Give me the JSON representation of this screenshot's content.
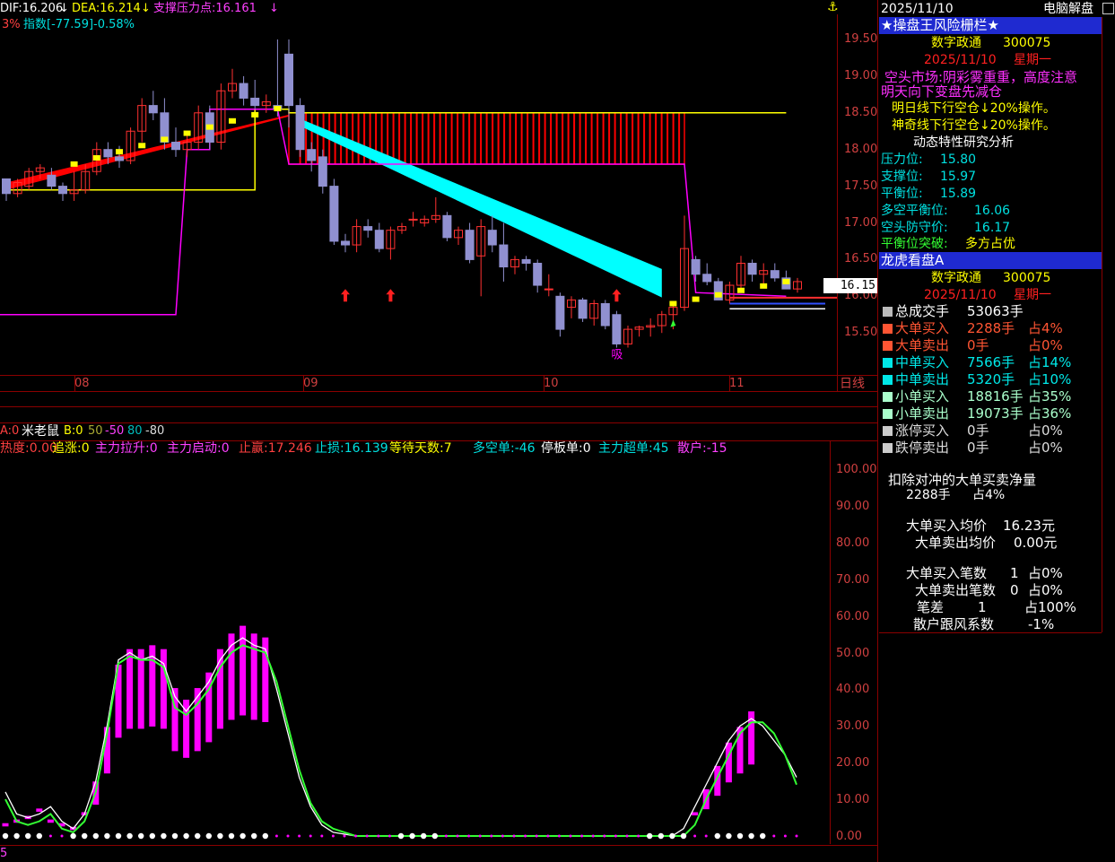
{
  "colors": {
    "bg": "#000000",
    "grid": "#8b0000",
    "red": "#ff0000",
    "cyan": "#00ffff",
    "yellow": "#ffff00",
    "magenta": "#ff00ff",
    "bull_candle": "#ff3030",
    "bear_candle": "#9090d0",
    "panel_title": "#1f2ad0",
    "green": "#33ff33"
  },
  "top": {
    "dif": "DIF:16.206",
    "dea": "DEA:16.214",
    "support": "支撑压力点:16.161",
    "line2_prefix": "3%",
    "line2_index": "指数[-77.59]-0.58%",
    "anchor_icon": "anchor-icon"
  },
  "price_axis": {
    "labels": [
      "19.50",
      "19.00",
      "18.50",
      "18.00",
      "17.50",
      "17.00",
      "16.50",
      "16.00",
      "15.50"
    ],
    "current": "16.15"
  },
  "time_axis": {
    "labels": [
      "08",
      "09",
      "10",
      "11"
    ],
    "period": "日线"
  },
  "indicator": {
    "name_a": "A:0",
    "name": "米老鼠",
    "name_b": "B:0",
    "levels": [
      "50",
      "-50",
      "80",
      "-80"
    ],
    "row2": [
      "热度:0.00",
      "追涨:0",
      "主力拉升:0",
      "主力启动:0",
      "止赢:17.246",
      "止损:16.139",
      "等待天数:7",
      "多空单:-46",
      "停板单:0",
      "主力超单:45",
      "散户:-15"
    ],
    "axis": [
      "100.00",
      "90.00",
      "80.00",
      "70.00",
      "60.00",
      "50.00",
      "40.00",
      "30.00",
      "20.00",
      "10.00",
      "0.00"
    ],
    "bottom_mark": "5"
  },
  "kline": {
    "marks": [
      "吸"
    ]
  },
  "chart_data": [
    {
      "type": "candlestick",
      "title": "",
      "ylim": [
        15.2,
        19.7
      ],
      "x_ticks": [
        "08",
        "09",
        "10",
        "11"
      ],
      "candles": [
        [
          17.6,
          17.6,
          17.3,
          17.4
        ],
        [
          17.4,
          17.6,
          17.35,
          17.55
        ],
        [
          17.5,
          17.75,
          17.45,
          17.7
        ],
        [
          17.7,
          17.8,
          17.6,
          17.75
        ],
        [
          17.65,
          17.75,
          17.45,
          17.5
        ],
        [
          17.5,
          17.55,
          17.3,
          17.4
        ],
        [
          17.4,
          17.7,
          17.3,
          17.45
        ],
        [
          17.45,
          17.8,
          17.4,
          17.7
        ],
        [
          17.7,
          18.1,
          17.65,
          18.0
        ],
        [
          18.0,
          18.1,
          17.8,
          17.9
        ],
        [
          17.9,
          18.05,
          17.75,
          17.85
        ],
        [
          17.85,
          18.3,
          17.8,
          18.25
        ],
        [
          18.25,
          18.7,
          18.1,
          18.6
        ],
        [
          18.6,
          18.8,
          18.4,
          18.5
        ],
        [
          18.5,
          18.7,
          18.0,
          18.1
        ],
        [
          18.1,
          18.3,
          17.9,
          18.0
        ],
        [
          18.0,
          18.2,
          17.9,
          18.1
        ],
        [
          18.1,
          18.6,
          18.0,
          18.5
        ],
        [
          18.5,
          18.6,
          18.0,
          18.1
        ],
        [
          18.1,
          18.9,
          18.0,
          18.8
        ],
        [
          18.8,
          19.1,
          18.7,
          18.9
        ],
        [
          18.9,
          19.0,
          18.6,
          18.7
        ],
        [
          18.7,
          18.95,
          18.55,
          18.6
        ],
        [
          18.6,
          18.75,
          18.5,
          18.65
        ],
        [
          18.6,
          19.5,
          18.45,
          18.55
        ],
        [
          19.3,
          19.5,
          18.3,
          18.6
        ],
        [
          18.6,
          18.7,
          17.9,
          18.0
        ],
        [
          18.0,
          18.1,
          17.7,
          17.85
        ],
        [
          17.9,
          18.0,
          17.4,
          17.5
        ],
        [
          17.5,
          17.6,
          16.7,
          16.75
        ],
        [
          16.75,
          16.85,
          16.6,
          16.7
        ],
        [
          16.7,
          17.05,
          16.6,
          16.95
        ],
        [
          16.95,
          17.05,
          16.8,
          16.9
        ],
        [
          16.9,
          17.0,
          16.6,
          16.65
        ],
        [
          16.65,
          16.95,
          16.5,
          16.9
        ],
        [
          16.9,
          17.0,
          16.85,
          16.95
        ],
        [
          17.05,
          17.15,
          16.95,
          17.05
        ],
        [
          17.0,
          17.1,
          16.95,
          17.05
        ],
        [
          17.05,
          17.35,
          17.0,
          17.1
        ],
        [
          17.1,
          17.15,
          16.75,
          16.8
        ],
        [
          16.8,
          16.95,
          16.7,
          16.9
        ],
        [
          16.9,
          17.0,
          16.45,
          16.5
        ],
        [
          16.55,
          17.05,
          16.0,
          16.95
        ],
        [
          16.9,
          17.1,
          16.6,
          16.7
        ],
        [
          16.7,
          17.0,
          16.2,
          16.4
        ],
        [
          16.4,
          16.55,
          16.3,
          16.5
        ],
        [
          16.5,
          16.55,
          16.35,
          16.45
        ],
        [
          16.45,
          16.5,
          16.05,
          16.15
        ],
        [
          16.1,
          16.3,
          16.0,
          16.1
        ],
        [
          16.0,
          16.05,
          15.45,
          15.55
        ],
        [
          15.85,
          16.0,
          15.7,
          15.95
        ],
        [
          15.95,
          15.98,
          15.65,
          15.7
        ],
        [
          15.7,
          15.95,
          15.6,
          15.9
        ],
        [
          15.9,
          15.95,
          15.55,
          15.6
        ],
        [
          15.75,
          15.8,
          15.3,
          15.35
        ],
        [
          15.35,
          15.6,
          15.3,
          15.55
        ],
        [
          15.55,
          15.6,
          15.45,
          15.58
        ],
        [
          15.58,
          15.7,
          15.45,
          15.6
        ],
        [
          15.6,
          15.8,
          15.5,
          15.75
        ],
        [
          15.75,
          15.9,
          15.55,
          15.85
        ],
        [
          15.85,
          17.1,
          15.8,
          16.65
        ],
        [
          16.5,
          16.55,
          16.2,
          16.3
        ],
        [
          16.3,
          16.45,
          16.15,
          16.2
        ],
        [
          16.2,
          16.25,
          15.95,
          15.95
        ],
        [
          15.95,
          16.2,
          15.9,
          16.15
        ],
        [
          16.15,
          16.55,
          16.1,
          16.45
        ],
        [
          16.45,
          16.5,
          16.2,
          16.3
        ],
        [
          16.3,
          16.45,
          16.15,
          16.35
        ],
        [
          16.35,
          16.45,
          16.2,
          16.25
        ],
        [
          16.25,
          16.35,
          16.1,
          16.1
        ],
        [
          16.1,
          16.25,
          16.05,
          16.2
        ]
      ]
    },
    {
      "type": "line",
      "title": "",
      "ylim": [
        0,
        100
      ],
      "axis": [
        "100.00",
        "0.00"
      ],
      "series": [
        {
          "values": [
            12,
            6,
            5,
            6,
            8,
            4,
            2,
            6,
            15,
            30,
            48,
            50,
            48,
            49,
            47,
            38,
            34,
            38,
            42,
            48,
            52,
            54,
            52,
            51,
            40,
            28,
            16,
            8,
            3,
            1,
            0.5,
            0,
            0,
            0,
            0,
            0,
            0,
            0,
            0,
            0,
            0,
            0,
            0,
            0,
            0,
            0,
            0,
            0,
            0,
            0,
            0,
            0,
            0,
            0,
            0,
            0,
            0,
            0,
            0,
            0,
            2,
            8,
            14,
            20,
            26,
            30,
            32,
            30,
            26,
            22,
            16
          ]
        },
        {
          "values": [
            10,
            4,
            3,
            4,
            6,
            2,
            1,
            4,
            12,
            28,
            47,
            49,
            48,
            48,
            46,
            35,
            33,
            36,
            40,
            46,
            50,
            52,
            51,
            50,
            42,
            30,
            18,
            9,
            4,
            2,
            1,
            0,
            0,
            0,
            0,
            0,
            0,
            0,
            0,
            0,
            0,
            0,
            0,
            0,
            0,
            0,
            0,
            0,
            0,
            0,
            0,
            0,
            0,
            0,
            0,
            0,
            0,
            0,
            0,
            0,
            0,
            3,
            10,
            16,
            22,
            28,
            31,
            31,
            28,
            22,
            14
          ]
        }
      ],
      "bars": [
        3,
        4,
        5,
        7,
        4,
        3,
        2,
        6,
        14,
        28,
        44,
        48,
        48,
        49,
        48,
        38,
        35,
        38,
        42,
        48,
        52,
        54,
        52,
        51,
        0,
        0,
        0,
        0,
        0,
        0,
        0,
        0,
        0,
        0,
        0,
        0,
        0,
        0,
        0,
        0,
        0,
        0,
        0,
        0,
        0,
        0,
        0,
        0,
        0,
        0,
        0,
        0,
        0,
        0,
        0,
        0,
        0,
        0,
        0,
        0,
        0,
        6,
        12,
        18,
        24,
        28,
        32,
        0,
        0,
        0,
        0
      ]
    }
  ],
  "panel1": {
    "window_date": "2025/11/10",
    "window_title": "电脑解盘",
    "title": "★操盘王风险栅栏★",
    "stock_name": "数字政通",
    "stock_code": "300075",
    "date": "2025/11/10",
    "weekday": "星期一",
    "market": "空头市场:阴彩雾重重，高度注意",
    "market2": "明天向下变盘先减仓",
    "op1": "明日线下行空仓↓20%操作。",
    "op2": "神奇线下行空仓↓20%操作。",
    "study": "动态特性研究分析",
    "rows": [
      [
        "压力位:",
        "15.80"
      ],
      [
        "支撑位:",
        "15.97"
      ],
      [
        "平衡位:",
        "15.89"
      ],
      [
        "多空平衡位:",
        "16.06"
      ],
      [
        "空头防守价:",
        "16.17"
      ]
    ],
    "breakout_label": "平衡位突破:",
    "breakout_value": "多方占优"
  },
  "panel2": {
    "title": "龙虎看盘A",
    "stock_name": "数字政通",
    "stock_code": "300075",
    "date": "2025/11/10",
    "weekday": "星期一",
    "rows": [
      {
        "label": "总成交手",
        "value": "53063手",
        "pct": "",
        "color": "#bbbbbb",
        "lc": "#ffffff"
      },
      {
        "label": "大单买入",
        "value": "2288手",
        "pct": "占4%",
        "color": "#ff5533",
        "lc": "#ff5533"
      },
      {
        "label": "大单卖出",
        "value": "0手",
        "pct": "占0%",
        "color": "#ff5533",
        "lc": "#ff5533"
      },
      {
        "label": "中单买入",
        "value": "7566手",
        "pct": "占14%",
        "color": "#00e8e8",
        "lc": "#00e8e8"
      },
      {
        "label": "中单卖出",
        "value": "5320手",
        "pct": "占10%",
        "color": "#00e8e8",
        "lc": "#00e8e8"
      },
      {
        "label": "小单买入",
        "value": "18816手",
        "pct": "占35%",
        "color": "#aaffcc",
        "lc": "#aaffcc"
      },
      {
        "label": "小单卖出",
        "value": "19073手",
        "pct": "占36%",
        "color": "#aaffcc",
        "lc": "#aaffcc"
      },
      {
        "label": "涨停买入",
        "value": "0手",
        "pct": "占0%",
        "color": "#cccccc",
        "lc": "#dddddd"
      },
      {
        "label": "跌停卖出",
        "value": "0手",
        "pct": "占0%",
        "color": "#cccccc",
        "lc": "#dddddd"
      }
    ],
    "net_title": "扣除对冲的大单买卖净量",
    "net_value": "2288手",
    "net_pct": "占4%",
    "avg_buy_label": "大单买入均价",
    "avg_buy": "16.23元",
    "avg_sell_label": "大单卖出均价",
    "avg_sell": "0.00元",
    "cnt_buy_label": "大单买入笔数",
    "cnt_buy": "1",
    "cnt_buy_pct": "占0%",
    "cnt_sell_label": "大单卖出笔数",
    "cnt_sell": "0",
    "cnt_sell_pct": "占0%",
    "diff_label": "笔差",
    "diff": "1",
    "diff_pct": "占100%",
    "retail_label": "散户跟风系数",
    "retail": "-1%"
  }
}
